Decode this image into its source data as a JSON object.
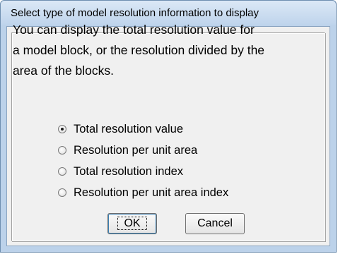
{
  "window": {
    "title": "Select type of model resolution information to display"
  },
  "description": {
    "lines": [
      "You can display the total resolution value for",
      "a model block, or the resolution divided by the",
      "area of the blocks."
    ]
  },
  "options": [
    {
      "label": "Total resolution value",
      "checked": true
    },
    {
      "label": "Resolution per unit area",
      "checked": false
    },
    {
      "label": "Total resolution index",
      "checked": false
    },
    {
      "label": "Resolution per unit area index",
      "checked": false
    }
  ],
  "buttons": {
    "ok": "OK",
    "cancel": "Cancel"
  }
}
